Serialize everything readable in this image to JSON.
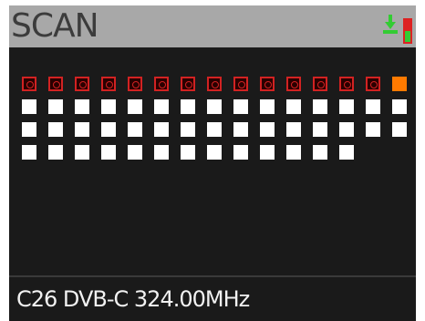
{
  "header": {
    "title": "SCAN",
    "status_icon": "signal-lock-icon",
    "status_colors": {
      "arrow": "#33cc33",
      "bar": "#dd2222",
      "bar_fill": "#33cc33"
    }
  },
  "scan_grid": {
    "columns": 15,
    "column_heights": [
      4,
      4,
      4,
      4,
      4,
      4,
      4,
      4,
      4,
      4,
      4,
      4,
      4,
      3,
      3
    ],
    "top_row": [
      "checked",
      "checked",
      "checked",
      "checked",
      "checked",
      "checked",
      "checked",
      "checked",
      "checked",
      "checked",
      "checked",
      "checked",
      "checked",
      "checked",
      "active"
    ],
    "colors": {
      "checked": "#d22222",
      "active": "#ff7a00",
      "filled": "#ffffff"
    }
  },
  "footer": {
    "channel_info": "C26 DVB-C 324.00MHz"
  }
}
